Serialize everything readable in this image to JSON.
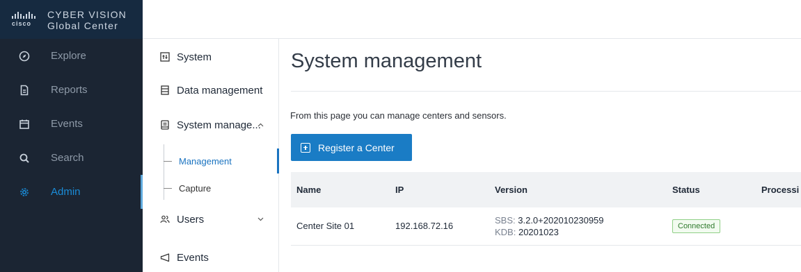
{
  "brand": {
    "logo_text": "cisco",
    "title_line1": "CYBER VISION",
    "title_line2": "Global Center"
  },
  "sidebar": {
    "items": [
      {
        "label": "Explore",
        "icon": "compass-icon"
      },
      {
        "label": "Reports",
        "icon": "document-icon"
      },
      {
        "label": "Events",
        "icon": "calendar-icon"
      },
      {
        "label": "Search",
        "icon": "search-icon"
      },
      {
        "label": "Admin",
        "icon": "gear-icon",
        "active": true
      }
    ]
  },
  "subnav": {
    "items": [
      {
        "label": "System",
        "icon": "system-icon"
      },
      {
        "label": "Data management",
        "icon": "database-icon"
      },
      {
        "label": "System manage...",
        "icon": "server-icon",
        "chevron": "^"
      },
      {
        "label": "Users",
        "icon": "users-icon",
        "chevron": "v"
      },
      {
        "label": "Events",
        "icon": "megaphone-icon"
      }
    ],
    "children": [
      {
        "label": "Management",
        "active": true
      },
      {
        "label": "Capture"
      }
    ]
  },
  "main": {
    "title": "System management",
    "intro": "From this page you can manage centers and sensors.",
    "register_button": "Register a Center",
    "table": {
      "headers": [
        "Name",
        "IP",
        "Version",
        "Status",
        "Processi"
      ],
      "rows": [
        {
          "name": "Center Site 01",
          "ip": "192.168.72.16",
          "version_sbs_key": "SBS:",
          "version_sbs": "3.2.0+202010230959",
          "version_kdb_key": "KDB:",
          "version_kdb": "20201023",
          "status": "Connected",
          "processing": ""
        }
      ]
    }
  },
  "colors": {
    "sidebar_bg": "#1b2533",
    "accent": "#1a7cc5",
    "status_connected": "#2f7a2c"
  }
}
